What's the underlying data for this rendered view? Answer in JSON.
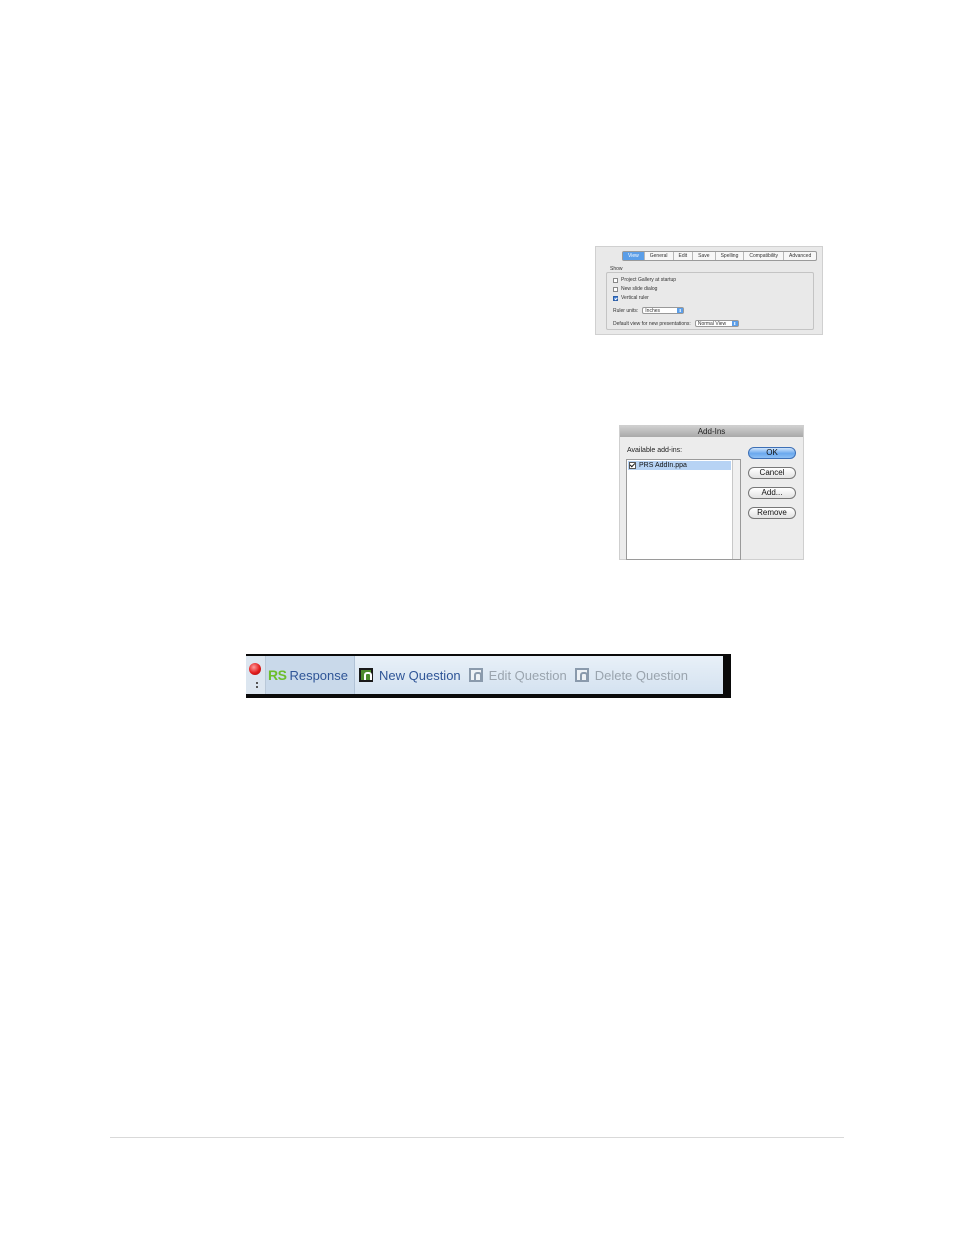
{
  "preferences": {
    "tabs": [
      "View",
      "General",
      "Edit",
      "Save",
      "Spelling",
      "Compatibility",
      "Advanced"
    ],
    "active_tab": "View",
    "show_group_label": "Show",
    "options": [
      {
        "label": "Project Gallery at startup",
        "checked": false
      },
      {
        "label": "New slide dialog",
        "checked": false
      },
      {
        "label": "Vertical ruler",
        "checked": true
      }
    ],
    "ruler_units_label": "Ruler units:",
    "ruler_units_value": "Inches",
    "default_view_label": "Default view for new presentations:",
    "default_view_value": "Normal View"
  },
  "addins_dialog": {
    "title": "Add-Ins",
    "available_label": "Available add-ins:",
    "items": [
      {
        "name": "PRS AddIn.ppa",
        "checked": true,
        "selected": true
      }
    ],
    "buttons": {
      "ok": "OK",
      "cancel": "Cancel",
      "add": "Add...",
      "remove": "Remove"
    }
  },
  "toolbar": {
    "logo": "RS",
    "response": "Response",
    "new_question": "New Question",
    "edit_question": "Edit Question",
    "delete_question": "Delete Question"
  }
}
